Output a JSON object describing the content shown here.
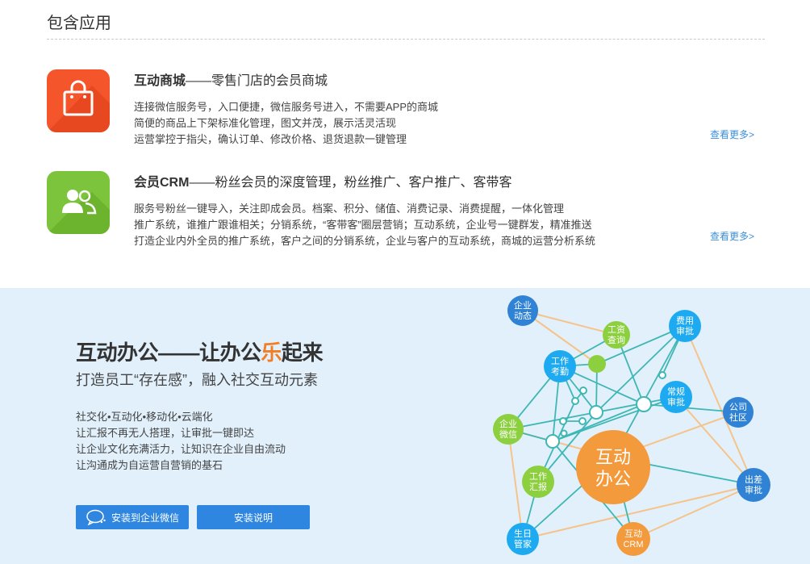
{
  "section": {
    "title": "包含应用"
  },
  "apps": [
    {
      "icon": "shopping-bag-icon",
      "color": "#f4552a",
      "name": "互动商城",
      "tagline": "——零售门店的会员商城",
      "lines": [
        "连接微信服务号，入口便捷，微信服务号进入，不需要APP的商城",
        "简便的商品上下架标准化管理，图文并茂，展示活灵活现",
        "运营掌控于指尖，确认订单、修改价格、退货退款一键管理"
      ],
      "more": "查看更多>"
    },
    {
      "icon": "members-icon",
      "color": "#7cc43b",
      "name": "会员CRM",
      "tagline": "——粉丝会员的深度管理，粉丝推广、客户推广、客带客",
      "lines": [
        "服务号粉丝一键导入，关注即成会员。档案、积分、储值、消费记录、消费提醒，一体化管理",
        "推广系统，谁推广跟谁相关；分销系统，“客带客”圈层营销；互动系统，企业号一键群发，精准推送",
        "打造企业内外全员的推广系统，客户之间的分销系统，企业与客户的互动系统，商城的运营分析系统"
      ],
      "more": "查看更多>"
    }
  ],
  "office": {
    "title_pre": "互动办公——让办公",
    "title_hl": "乐",
    "title_post": "起来",
    "subtitle": "打造员工“存在感”，融入社交互动元素",
    "lines": [
      "社交化•互动化•移动化•云端化",
      "让汇报不再无人搭理，让审批一键即达",
      "让企业文化充满活力，让知识在企业自由流动",
      "让沟通成为自运营自营销的基石"
    ],
    "btn_wechat": "安装到企业微信",
    "btn_guide": "安装说明",
    "accent": "#f27d24",
    "network": {
      "center": [
        "互动",
        "办公"
      ],
      "nodes": [
        {
          "id": "news",
          "lines": [
            "企业",
            "动态"
          ]
        },
        {
          "id": "salary",
          "lines": [
            "工资",
            "查询"
          ]
        },
        {
          "id": "expense",
          "lines": [
            "费用",
            "审批"
          ]
        },
        {
          "id": "attendance",
          "lines": [
            "工作",
            "考勤"
          ]
        },
        {
          "id": "routine",
          "lines": [
            "常规",
            "审批"
          ]
        },
        {
          "id": "community",
          "lines": [
            "公司",
            "社区"
          ]
        },
        {
          "id": "wechat",
          "lines": [
            "企业",
            "微信"
          ]
        },
        {
          "id": "report",
          "lines": [
            "工作",
            "汇报"
          ]
        },
        {
          "id": "trip",
          "lines": [
            "出差",
            "审批"
          ]
        },
        {
          "id": "birthday",
          "lines": [
            "生日",
            "管家"
          ]
        },
        {
          "id": "crm",
          "lines": [
            "互动",
            "CRM"
          ]
        }
      ]
    }
  }
}
